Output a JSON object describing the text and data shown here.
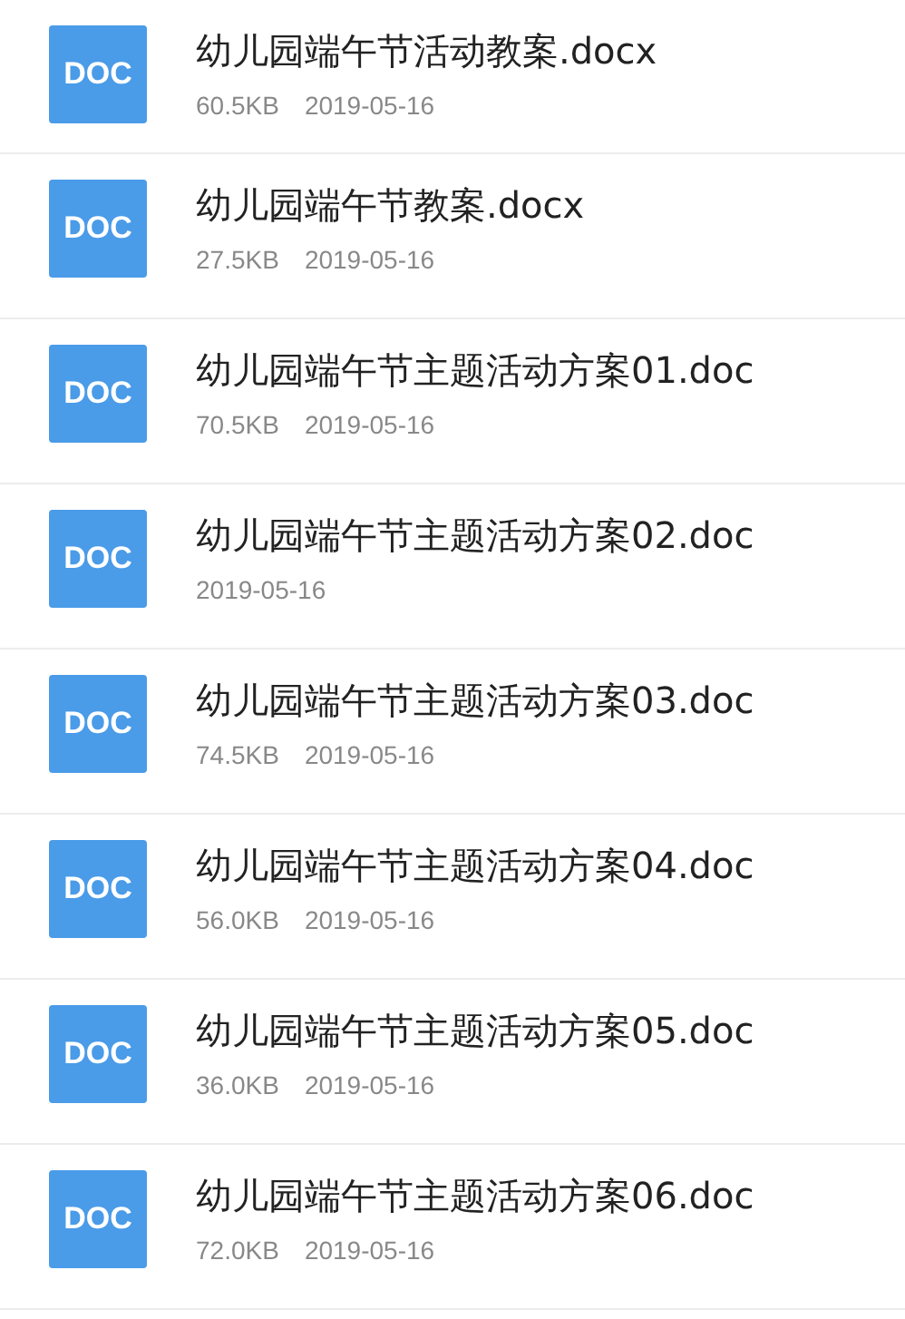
{
  "files": [
    {
      "icon": "DOC",
      "name": "幼儿园端午节活动教案.docx",
      "size": "60.5KB",
      "date": "2019-05-16"
    },
    {
      "icon": "DOC",
      "name": "幼儿园端午节教案.docx",
      "size": "27.5KB",
      "date": "2019-05-16"
    },
    {
      "icon": "DOC",
      "name": "幼儿园端午节主题活动方案01.doc",
      "size": "70.5KB",
      "date": "2019-05-16"
    },
    {
      "icon": "DOC",
      "name": "幼儿园端午节主题活动方案02.doc",
      "date": "2019-05-16"
    },
    {
      "icon": "DOC",
      "name": "幼儿园端午节主题活动方案03.doc",
      "size": "74.5KB",
      "date": "2019-05-16"
    },
    {
      "icon": "DOC",
      "name": "幼儿园端午节主题活动方案04.doc",
      "size": "56.0KB",
      "date": "2019-05-16"
    },
    {
      "icon": "DOC",
      "name": "幼儿园端午节主题活动方案05.doc",
      "size": "36.0KB",
      "date": "2019-05-16"
    },
    {
      "icon": "DOC",
      "name": "幼儿园端午节主题活动方案06.doc",
      "size": "72.0KB",
      "date": "2019-05-16"
    }
  ]
}
